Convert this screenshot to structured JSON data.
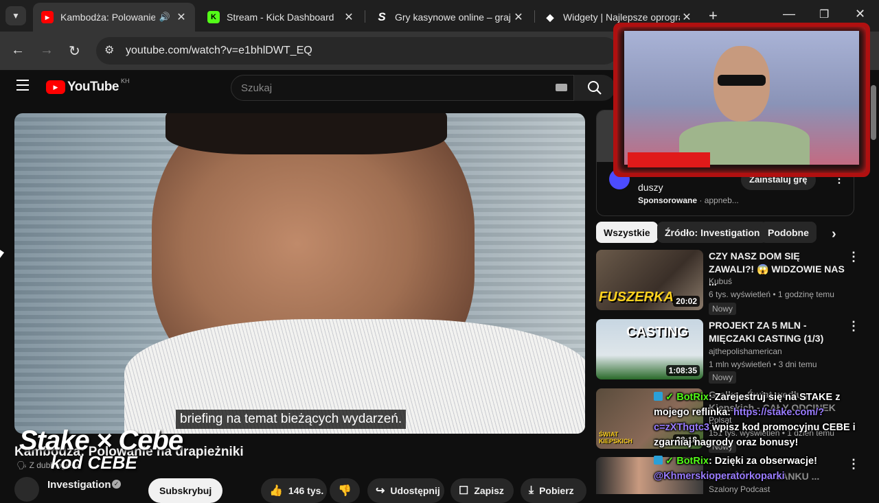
{
  "browser": {
    "tabs": [
      {
        "title": "Kambodża: Polowanie na",
        "favicon": "youtube-icon",
        "active": true
      },
      {
        "title": "Stream - Kick Dashboard",
        "favicon": "kick-icon",
        "active": false
      },
      {
        "title": "Gry kasynowe online – graj w",
        "favicon": "stake-icon",
        "active": false
      },
      {
        "title": "Widgety | Najlepsze oprogra",
        "favicon": "widget-icon",
        "active": false
      }
    ],
    "url": "youtube.com/watch?v=e1bhlDWT_EQ"
  },
  "youtube": {
    "logo_text": "YouTube",
    "country_code": "KH",
    "search_placeholder": "Szukaj"
  },
  "video": {
    "subtitle": "briefing na temat bieżących wydarzeń.",
    "title": "Kambodża: Polowanie na drapieżniki",
    "dubbed_label": "Z dubbingiem",
    "channel": "Investigation",
    "subscribe_label": "Subskrybuj",
    "likes": "146 tys.",
    "share_label": "Udostępnij",
    "save_label": "Zapisz",
    "download_label": "Pobierz"
  },
  "overlay": {
    "brand_line1": "Stake × Cebe",
    "brand_line2": "kod CEBE"
  },
  "ad": {
    "title_partial": "duszy",
    "sponsored": "Sponsorowane",
    "advertiser": "appneb...",
    "cta": "Zainstaluj grę"
  },
  "chips": [
    "Wszystkie",
    "Źródło: Investigation",
    "Podobne"
  ],
  "recommendations": [
    {
      "title": "CZY NASZ DOM SIĘ ZAWALI?! 😱 WIDZOWIE NAS ...",
      "channel": "Kubuś",
      "meta": "6 tys. wyświetleń • 1 godzinę temu",
      "badge": "Nowy",
      "duration": "20:02",
      "thumb_text": "FUSZERKA"
    },
    {
      "title": "PROJEKT ZA 5 MLN - MIĘCZAKI CASTING (1/3)",
      "channel": "ajthepolishamerican",
      "meta": "1 mln wyświetleń • 3 dni temu",
      "badge": "Nowy",
      "duration": "1:08:35",
      "thumb_text": "CASTING"
    },
    {
      "title": "Gralka - Świat według Kiepskich - CAŁY ODCINEK ...",
      "channel": "Polsat",
      "meta": "151 tys. wyświetleń • 1 dzień temu",
      "badge": "Nowy",
      "duration": "23:18",
      "thumb_text": "ŚWIAT KIEPSKICH"
    },
    {
      "title": "MIŁOŚĆ NA ... JANKU ...",
      "channel": "Szalony Podcast",
      "meta": "",
      "badge": "",
      "duration": "",
      "thumb_text": ""
    }
  ],
  "chat": [
    {
      "user": "BotRix",
      "segments": [
        ": Zarejestruj się na STAKE z mojego reflinka: ",
        "https://stake.com/?c=zXThgtc3",
        " wpisz kod promocyjnu CEBE i zgarniaj nagrody oraz bonusy!"
      ]
    },
    {
      "user": "BotRix",
      "segments": [
        ": Dzięki za obserwacje!",
        "@Khmerskioperatorkoparki"
      ]
    }
  ]
}
